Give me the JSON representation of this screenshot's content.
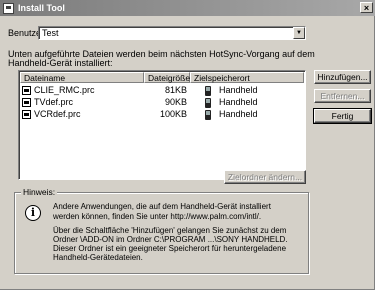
{
  "window": {
    "title": "Install Tool",
    "close_glyph": "×"
  },
  "user": {
    "label": "Benutzer:",
    "value": "Test"
  },
  "intro": {
    "line1": "Unten aufgeführte Dateien werden beim nächsten HotSync-Vorgang auf dem",
    "line2": "Handheld-Gerät installiert:"
  },
  "list": {
    "columns": [
      "Dateiname",
      "Dateigröße",
      "Zielspeicherort"
    ],
    "rows": [
      {
        "name": "CLIE_RMC.prc",
        "size": "81KB",
        "target": "Handheld"
      },
      {
        "name": "TVdef.prc",
        "size": "90KB",
        "target": "Handheld"
      },
      {
        "name": "VCRdef.prc",
        "size": "100KB",
        "target": "Handheld"
      }
    ]
  },
  "buttons": {
    "add": "Hinzufügen...",
    "remove": "Entfernen...",
    "done": "Fertig",
    "target_folder": "Zielordner ändern..."
  },
  "hint": {
    "legend": "Hinweis:",
    "line1": "Andere Anwendungen, die auf dem Handheld-Gerät installiert",
    "line2": "werden können, finden Sie unter http://www.palm.com/intl/.",
    "p2_line1": "Über die Schaltfläche 'Hinzufügen' gelangen Sie zunächst zu dem",
    "p2_line2": "Ordner \\ADD-ON im Ordner C:\\PROGRAM ...\\SONY HANDHELD.",
    "p2_line3": "Dieser Ordner ist ein geeigneter Speicherort für heruntergeladene",
    "p2_line4": "Handheld-Gerätedateien."
  },
  "icons": {
    "title": "install-tool-icon",
    "file": "prc-file-icon",
    "device": "handheld-device-icon",
    "info": "information-icon"
  }
}
